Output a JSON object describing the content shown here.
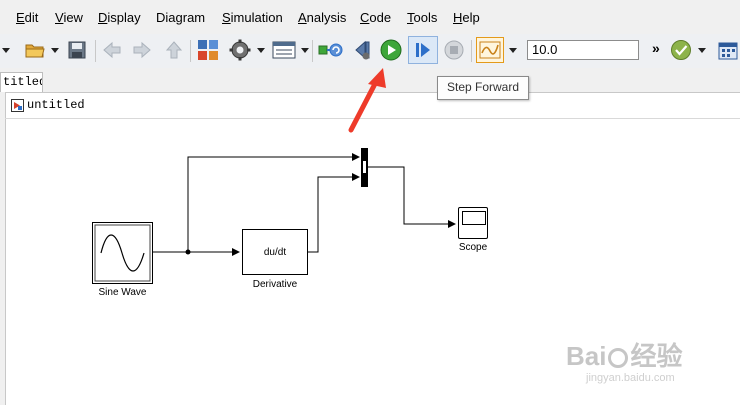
{
  "menu": {
    "items": [
      {
        "underline": "E",
        "rest": "dit"
      },
      {
        "underline": "V",
        "rest": "iew"
      },
      {
        "underline": "D",
        "rest": "isplay"
      },
      {
        "underline": "",
        "rest": "Diagram"
      },
      {
        "underline": "S",
        "rest": "imulation"
      },
      {
        "underline": "A",
        "rest": "nalysis"
      },
      {
        "underline": "C",
        "rest": "ode"
      },
      {
        "underline": "T",
        "rest": "ools"
      },
      {
        "underline": "H",
        "rest": "elp"
      }
    ]
  },
  "toolbar": {
    "stop_time": "10.0",
    "overflow": "»"
  },
  "tooltip": "Step Forward",
  "tab": {
    "label": "titled"
  },
  "breadcrumb": {
    "label": "untitled"
  },
  "blocks": {
    "sine_wave": {
      "label": "Sine Wave"
    },
    "derivative": {
      "label": "Derivative",
      "inner": "du/dt"
    },
    "scope": {
      "label": "Scope"
    }
  },
  "watermark": {
    "brand_left": "Bai",
    "brand_right": "经验",
    "url": "jingyan.baidu.com"
  },
  "colors": {
    "run_green": "#3ea63a",
    "annotation_red": "#ee3b2a",
    "step_blue": "#2d6fc9"
  }
}
